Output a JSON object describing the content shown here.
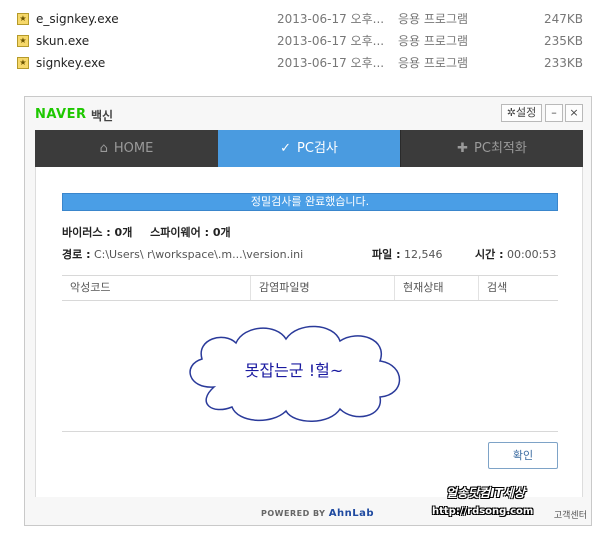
{
  "files": [
    {
      "name": "e_signkey.exe",
      "date": "2013-06-17 오후...",
      "type": "응용 프로그램",
      "size": "247KB"
    },
    {
      "name": "skun.exe",
      "date": "2013-06-17 오후...",
      "type": "응용 프로그램",
      "size": "235KB"
    },
    {
      "name": "signkey.exe",
      "date": "2013-06-17 오후...",
      "type": "응용 프로그램",
      "size": "233KB"
    }
  ],
  "window": {
    "logo": "NAVER",
    "logo_sub": "백신",
    "settings_label": "설정",
    "minimize_label": "–",
    "close_label": "×"
  },
  "tabs": [
    {
      "label": "HOME",
      "icon": "home-icon"
    },
    {
      "label": "PC검사",
      "icon": "shield-check-icon"
    },
    {
      "label": "PC최적화",
      "icon": "puzzle-icon"
    }
  ],
  "scan": {
    "banner": "정밀검사를 완료했습니다.",
    "virus": "바이러스 : 0개",
    "spyware": "스파이웨어 : 0개",
    "path_label": "경로 :",
    "path_value": "C:\\Users\\        r\\workspace\\.m...\\version.ini",
    "file_label": "파일 :",
    "file_value": "12,546",
    "time_label": "시간 :",
    "time_value": "00:00:53"
  },
  "table": {
    "headers": [
      "악성코드",
      "감염파일명",
      "현재상태",
      "검색"
    ]
  },
  "annotation": "못잡는군 !헐~",
  "confirm_label": "확인",
  "footer": {
    "powered_prefix": "POWERED BY",
    "powered_brand": "AhnLab",
    "support": "고객센터"
  },
  "watermark": {
    "line1": "얼송닷컴IT세상",
    "line2": "http://rdsong.com"
  },
  "colors": {
    "accent": "#4a9be0",
    "naver_green": "#1ec800",
    "tab_bar": "#3b3b3b"
  }
}
